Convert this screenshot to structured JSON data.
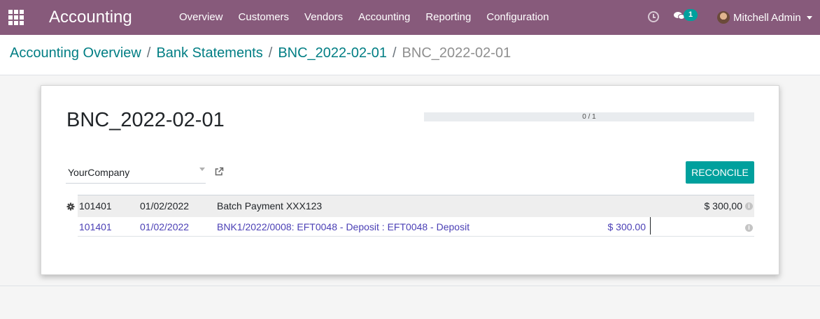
{
  "navbar": {
    "app_title": "Accounting",
    "menu": [
      "Overview",
      "Customers",
      "Vendors",
      "Accounting",
      "Reporting",
      "Configuration"
    ],
    "chat_count": "1",
    "user_name": "Mitchell Admin"
  },
  "breadcrumb": {
    "items": [
      "Accounting Overview",
      "Bank Statements",
      "BNC_2022-02-01"
    ],
    "current": "BNC_2022-02-01",
    "separator": "/"
  },
  "statement": {
    "title": "BNC_2022-02-01",
    "progress": {
      "done": 0,
      "total": 1,
      "text": "0 / 1"
    },
    "partner": "YourCompany",
    "reconcile_label": "RECONCILE"
  },
  "table": {
    "head_row": {
      "code": "101401",
      "date": "01/02/2022",
      "label": "Batch Payment XXX123",
      "amount_right": "$ 300,00"
    },
    "line_row": {
      "code": "101401",
      "date": "01/02/2022",
      "label": "BNK1/2022/0008: EFT0048 - Deposit : EFT0048 - Deposit",
      "amount_left": "$ 300.00"
    }
  },
  "colors": {
    "navbar": "#875a7b",
    "accent": "#00a09d",
    "link": "#017e84",
    "line_text": "#4a3fb5"
  },
  "icons": [
    "apps-icon",
    "clock-icon",
    "chat-icon",
    "caret-down-icon",
    "external-link-icon",
    "gear-icon",
    "info-icon"
  ]
}
